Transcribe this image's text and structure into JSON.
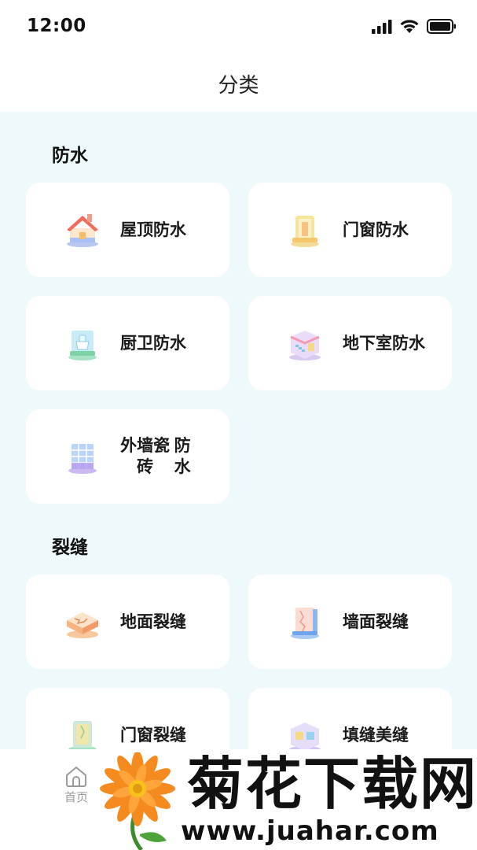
{
  "status_bar": {
    "time": "12:00"
  },
  "header": {
    "title": "分类"
  },
  "sections": [
    {
      "title": "防水",
      "items": [
        {
          "label": "屋顶防水",
          "icon": "house-roof-icon"
        },
        {
          "label": "门窗防水",
          "icon": "door-window-icon"
        },
        {
          "label": "厨卫防水",
          "icon": "bathroom-icon"
        },
        {
          "label": "地下室防水",
          "icon": "basement-icon"
        },
        {
          "label": "外墙瓷砖防水",
          "label_line1": "外墙瓷砖",
          "label_line2": "防水",
          "icon": "wall-tiles-icon"
        }
      ]
    },
    {
      "title": "裂缝",
      "items": [
        {
          "label": "地面裂缝",
          "icon": "floor-crack-icon"
        },
        {
          "label": "墙面裂缝",
          "icon": "wall-crack-icon"
        },
        {
          "label": "门窗裂缝",
          "icon": "door-crack-icon"
        },
        {
          "label": "填缝美缝",
          "icon": "tile-grout-icon"
        }
      ]
    }
  ],
  "tab_bar": {
    "home_label": "首页"
  },
  "watermark": {
    "title": "菊花下载网",
    "url": "www.juahar.com"
  },
  "colors": {
    "background": "#eef9fb",
    "card": "#ffffff",
    "text": "#1a1a1a"
  }
}
